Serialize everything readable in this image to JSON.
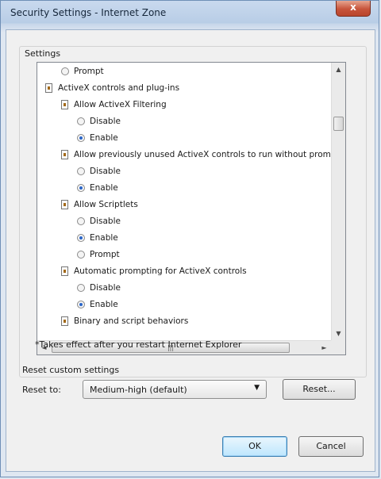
{
  "window": {
    "title": "Security Settings - Internet Zone",
    "close_label": "x"
  },
  "settings_group": {
    "label": "Settings"
  },
  "tree": [
    {
      "kind": "radio",
      "label": "Prompt",
      "selected": false,
      "indent": 1
    },
    {
      "kind": "category",
      "label": "ActiveX controls and plug-ins",
      "indent": 0
    },
    {
      "kind": "setting",
      "label": "Allow ActiveX Filtering",
      "indent": 1
    },
    {
      "kind": "radio",
      "label": "Disable",
      "selected": false,
      "indent": 2
    },
    {
      "kind": "radio",
      "label": "Enable",
      "selected": true,
      "indent": 2
    },
    {
      "kind": "setting",
      "label": "Allow previously unused ActiveX controls to run without prom",
      "indent": 1
    },
    {
      "kind": "radio",
      "label": "Disable",
      "selected": false,
      "indent": 2
    },
    {
      "kind": "radio",
      "label": "Enable",
      "selected": true,
      "indent": 2
    },
    {
      "kind": "setting",
      "label": "Allow Scriptlets",
      "indent": 1
    },
    {
      "kind": "radio",
      "label": "Disable",
      "selected": false,
      "indent": 2
    },
    {
      "kind": "radio",
      "label": "Enable",
      "selected": true,
      "indent": 2
    },
    {
      "kind": "radio",
      "label": "Prompt",
      "selected": false,
      "indent": 2
    },
    {
      "kind": "setting",
      "label": "Automatic prompting for ActiveX controls",
      "indent": 1
    },
    {
      "kind": "radio",
      "label": "Disable",
      "selected": false,
      "indent": 2
    },
    {
      "kind": "radio",
      "label": "Enable",
      "selected": true,
      "indent": 2
    },
    {
      "kind": "setting",
      "label": "Binary and script behaviors",
      "indent": 1
    }
  ],
  "note": "*Takes effect after you restart Internet Explorer",
  "reset": {
    "section_label": "Reset custom settings",
    "reset_to_label": "Reset to:",
    "selected_value": "Medium-high (default)",
    "reset_button": "Reset..."
  },
  "buttons": {
    "ok": "OK",
    "cancel": "Cancel"
  },
  "scroll": {
    "up_arrow": "▲",
    "down_arrow": "▼",
    "left_arrow": "◄",
    "right_arrow": "►",
    "hthumb_grip": "|||"
  }
}
